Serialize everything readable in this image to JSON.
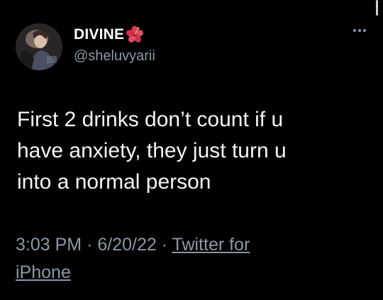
{
  "author": {
    "display_name": "DIVINE",
    "name_emoji": "hibiscus-icon",
    "handle": "@sheluvyarii"
  },
  "tweet": {
    "text_lines": [
      "First 2 drinks don’t count if u",
      "have anxiety, they just turn u",
      "into a normal person"
    ]
  },
  "meta": {
    "time": "3:03 PM",
    "separator": "·",
    "date": "6/20/22",
    "source_part1": "Twitter for",
    "source_part2": "iPhone"
  },
  "icons": {
    "more": "more-options-icon",
    "avatar": "profile-avatar"
  },
  "colors": {
    "background": "#000000",
    "text": "#e7e9ea",
    "secondary_text": "#8b98a5",
    "emoji": "#e03a5a"
  }
}
